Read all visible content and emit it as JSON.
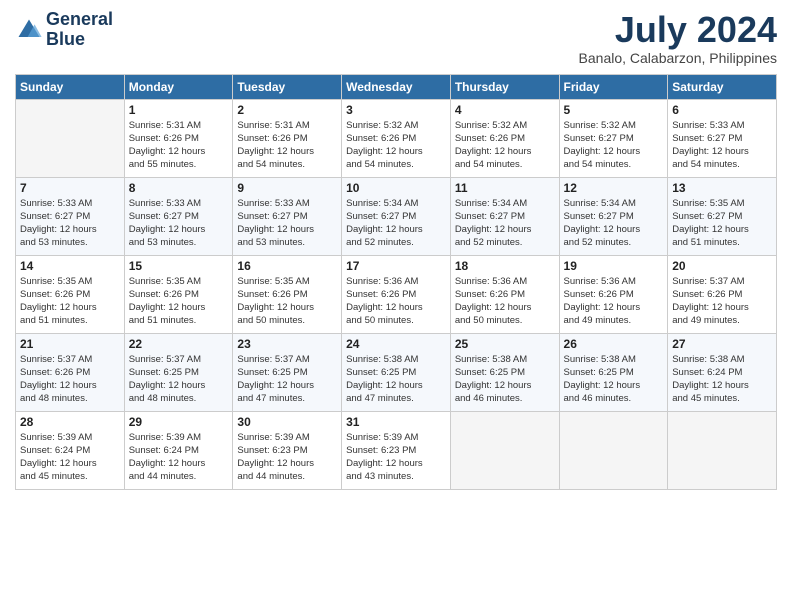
{
  "logo": {
    "line1": "General",
    "line2": "Blue"
  },
  "title": "July 2024",
  "subtitle": "Banalo, Calabarzon, Philippines",
  "days_of_week": [
    "Sunday",
    "Monday",
    "Tuesday",
    "Wednesday",
    "Thursday",
    "Friday",
    "Saturday"
  ],
  "weeks": [
    [
      {
        "num": "",
        "info": ""
      },
      {
        "num": "1",
        "info": "Sunrise: 5:31 AM\nSunset: 6:26 PM\nDaylight: 12 hours\nand 55 minutes."
      },
      {
        "num": "2",
        "info": "Sunrise: 5:31 AM\nSunset: 6:26 PM\nDaylight: 12 hours\nand 54 minutes."
      },
      {
        "num": "3",
        "info": "Sunrise: 5:32 AM\nSunset: 6:26 PM\nDaylight: 12 hours\nand 54 minutes."
      },
      {
        "num": "4",
        "info": "Sunrise: 5:32 AM\nSunset: 6:26 PM\nDaylight: 12 hours\nand 54 minutes."
      },
      {
        "num": "5",
        "info": "Sunrise: 5:32 AM\nSunset: 6:27 PM\nDaylight: 12 hours\nand 54 minutes."
      },
      {
        "num": "6",
        "info": "Sunrise: 5:33 AM\nSunset: 6:27 PM\nDaylight: 12 hours\nand 54 minutes."
      }
    ],
    [
      {
        "num": "7",
        "info": "Sunrise: 5:33 AM\nSunset: 6:27 PM\nDaylight: 12 hours\nand 53 minutes."
      },
      {
        "num": "8",
        "info": "Sunrise: 5:33 AM\nSunset: 6:27 PM\nDaylight: 12 hours\nand 53 minutes."
      },
      {
        "num": "9",
        "info": "Sunrise: 5:33 AM\nSunset: 6:27 PM\nDaylight: 12 hours\nand 53 minutes."
      },
      {
        "num": "10",
        "info": "Sunrise: 5:34 AM\nSunset: 6:27 PM\nDaylight: 12 hours\nand 52 minutes."
      },
      {
        "num": "11",
        "info": "Sunrise: 5:34 AM\nSunset: 6:27 PM\nDaylight: 12 hours\nand 52 minutes."
      },
      {
        "num": "12",
        "info": "Sunrise: 5:34 AM\nSunset: 6:27 PM\nDaylight: 12 hours\nand 52 minutes."
      },
      {
        "num": "13",
        "info": "Sunrise: 5:35 AM\nSunset: 6:27 PM\nDaylight: 12 hours\nand 51 minutes."
      }
    ],
    [
      {
        "num": "14",
        "info": "Sunrise: 5:35 AM\nSunset: 6:26 PM\nDaylight: 12 hours\nand 51 minutes."
      },
      {
        "num": "15",
        "info": "Sunrise: 5:35 AM\nSunset: 6:26 PM\nDaylight: 12 hours\nand 51 minutes."
      },
      {
        "num": "16",
        "info": "Sunrise: 5:35 AM\nSunset: 6:26 PM\nDaylight: 12 hours\nand 50 minutes."
      },
      {
        "num": "17",
        "info": "Sunrise: 5:36 AM\nSunset: 6:26 PM\nDaylight: 12 hours\nand 50 minutes."
      },
      {
        "num": "18",
        "info": "Sunrise: 5:36 AM\nSunset: 6:26 PM\nDaylight: 12 hours\nand 50 minutes."
      },
      {
        "num": "19",
        "info": "Sunrise: 5:36 AM\nSunset: 6:26 PM\nDaylight: 12 hours\nand 49 minutes."
      },
      {
        "num": "20",
        "info": "Sunrise: 5:37 AM\nSunset: 6:26 PM\nDaylight: 12 hours\nand 49 minutes."
      }
    ],
    [
      {
        "num": "21",
        "info": "Sunrise: 5:37 AM\nSunset: 6:26 PM\nDaylight: 12 hours\nand 48 minutes."
      },
      {
        "num": "22",
        "info": "Sunrise: 5:37 AM\nSunset: 6:25 PM\nDaylight: 12 hours\nand 48 minutes."
      },
      {
        "num": "23",
        "info": "Sunrise: 5:37 AM\nSunset: 6:25 PM\nDaylight: 12 hours\nand 47 minutes."
      },
      {
        "num": "24",
        "info": "Sunrise: 5:38 AM\nSunset: 6:25 PM\nDaylight: 12 hours\nand 47 minutes."
      },
      {
        "num": "25",
        "info": "Sunrise: 5:38 AM\nSunset: 6:25 PM\nDaylight: 12 hours\nand 46 minutes."
      },
      {
        "num": "26",
        "info": "Sunrise: 5:38 AM\nSunset: 6:25 PM\nDaylight: 12 hours\nand 46 minutes."
      },
      {
        "num": "27",
        "info": "Sunrise: 5:38 AM\nSunset: 6:24 PM\nDaylight: 12 hours\nand 45 minutes."
      }
    ],
    [
      {
        "num": "28",
        "info": "Sunrise: 5:39 AM\nSunset: 6:24 PM\nDaylight: 12 hours\nand 45 minutes."
      },
      {
        "num": "29",
        "info": "Sunrise: 5:39 AM\nSunset: 6:24 PM\nDaylight: 12 hours\nand 44 minutes."
      },
      {
        "num": "30",
        "info": "Sunrise: 5:39 AM\nSunset: 6:23 PM\nDaylight: 12 hours\nand 44 minutes."
      },
      {
        "num": "31",
        "info": "Sunrise: 5:39 AM\nSunset: 6:23 PM\nDaylight: 12 hours\nand 43 minutes."
      },
      {
        "num": "",
        "info": ""
      },
      {
        "num": "",
        "info": ""
      },
      {
        "num": "",
        "info": ""
      }
    ]
  ]
}
